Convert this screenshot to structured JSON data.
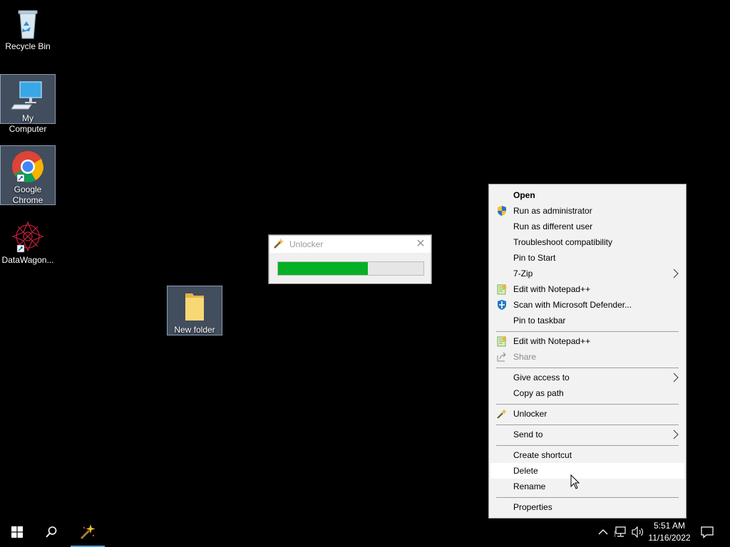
{
  "desktop": {
    "icons": [
      {
        "label": "Recycle Bin"
      },
      {
        "label": "My Computer"
      },
      {
        "label_line1": "Google",
        "label_line2": "Chrome"
      },
      {
        "label": "DataWagon..."
      },
      {
        "label": "New folder"
      }
    ]
  },
  "unlocker_window": {
    "title": "Unlocker",
    "progress": 0.62,
    "progress_color": "#06b025"
  },
  "context_menu": {
    "items": [
      {
        "label": "Open"
      },
      {
        "label": "Run as administrator",
        "icon": "uac-shield-icon"
      },
      {
        "label": "Run as different user"
      },
      {
        "label": "Troubleshoot compatibility"
      },
      {
        "label": "Pin to Start"
      },
      {
        "label": "7-Zip"
      },
      {
        "label": "Edit with Notepad++",
        "icon": "notepadpp-icon"
      },
      {
        "label": "Scan with Microsoft Defender...",
        "icon": "defender-icon"
      },
      {
        "label": "Pin to taskbar"
      },
      {
        "label": "Edit with Notepad++",
        "icon": "notepadpp-icon"
      },
      {
        "label": "Share",
        "icon": "share-icon"
      },
      {
        "label": "Give access to"
      },
      {
        "label": "Copy as path"
      },
      {
        "label": "Unlocker",
        "icon": "unlocker-wand-icon"
      },
      {
        "label": "Send to"
      },
      {
        "label": "Create shortcut"
      },
      {
        "label": "Delete"
      },
      {
        "label": "Rename"
      },
      {
        "label": "Properties"
      }
    ]
  },
  "taskbar": {
    "clock_time": "5:51 AM",
    "clock_date": "11/16/2022"
  }
}
